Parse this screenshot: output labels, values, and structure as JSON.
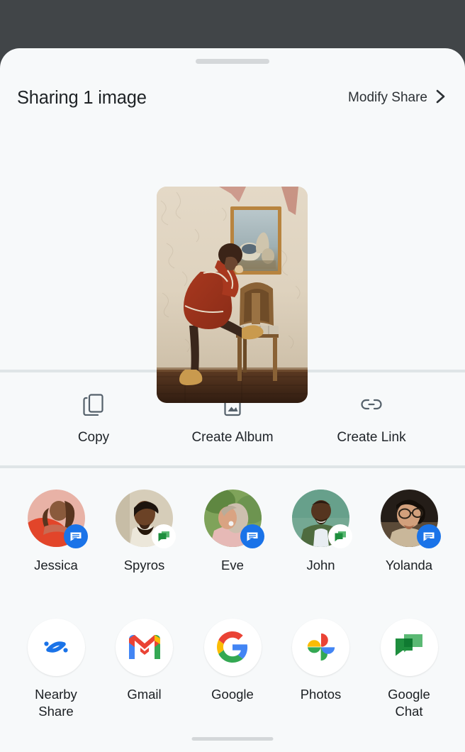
{
  "window": {
    "backdrop_color": "#414548",
    "sheet_color": "#f7f9fa"
  },
  "header": {
    "title": "Sharing 1 image",
    "modify_share_label": "Modify Share",
    "chevron_icon": "chevron-right-icon",
    "drag_handle": "drag-handle"
  },
  "preview": {
    "image_alt": "Woman in rust-colored coat leaning on a wooden chair beside a framed still-life painting on a textured cream wall",
    "count": 1
  },
  "actions": [
    {
      "label": "Copy",
      "icon": "copy-icon"
    },
    {
      "label": "Create Album",
      "icon": "album-icon"
    },
    {
      "label": "Create Link",
      "icon": "link-icon"
    }
  ],
  "contacts": [
    {
      "name": "Jessica",
      "app": "messages",
      "badge_icon": "messages-badge-icon",
      "avatar_bg": "#e3a79b"
    },
    {
      "name": "Spyros",
      "app": "chat",
      "badge_icon": "chat-badge-icon",
      "avatar_bg": "#cfc7b6"
    },
    {
      "name": "Eve",
      "app": "messages",
      "badge_icon": "messages-badge-icon",
      "avatar_bg": "#8ba66b"
    },
    {
      "name": "John",
      "app": "chat",
      "badge_icon": "chat-badge-icon",
      "avatar_bg": "#5f9b84"
    },
    {
      "name": "Yolanda",
      "app": "messages",
      "badge_icon": "messages-badge-icon",
      "avatar_bg": "#2e2722"
    }
  ],
  "apps": [
    {
      "label": "Nearby\nShare",
      "icon": "nearby-share-icon"
    },
    {
      "label": "Gmail",
      "icon": "gmail-icon"
    },
    {
      "label": "Google",
      "icon": "google-icon"
    },
    {
      "label": "Photos",
      "icon": "google-photos-icon"
    },
    {
      "label": "Google\nChat",
      "icon": "google-chat-icon"
    }
  ],
  "colors": {
    "messages_blue": "#1a73e8",
    "chat_green": "#34a853",
    "google_red": "#ea4335",
    "google_yellow": "#fbbc04",
    "google_green": "#34a853",
    "google_blue": "#4285f4",
    "nearby_blue": "#1a73e8",
    "text_primary": "#1f2326"
  },
  "system": {
    "home_indicator": "home-indicator"
  }
}
